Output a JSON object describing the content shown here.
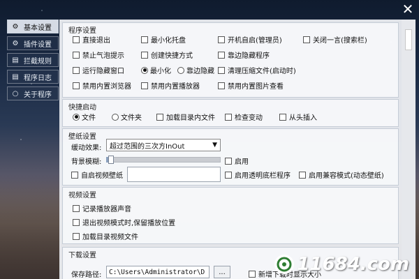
{
  "window": {
    "close_glyph": "✕"
  },
  "sidebar": {
    "items": [
      {
        "label": "基本设置",
        "icon": "gear-icon",
        "glyph": "⚙",
        "active": true
      },
      {
        "label": "插件设置",
        "icon": "plugin-icon",
        "glyph": "⚙",
        "active": false
      },
      {
        "label": "拦截规则",
        "icon": "rules-icon",
        "glyph": "▤",
        "active": false
      },
      {
        "label": "程序日志",
        "icon": "log-icon",
        "glyph": "▤",
        "active": false
      },
      {
        "label": "关于程序",
        "icon": "about-icon",
        "glyph": "○",
        "active": false
      }
    ]
  },
  "settings": {
    "program": {
      "title": "程序设置",
      "exit_direct": "直接退出",
      "minimize_tray": "最小化托盘",
      "autostart_admin": "开机自启(管理员)",
      "close_one_word": "关闭一言(搜索栏)",
      "disable_bubble": "禁止气泡提示",
      "create_shortcut": "创建快捷方式",
      "edge_hide": "靠边隐藏程序",
      "run_hide_window": "运行隐藏窗口",
      "radio_minimize": "最小化",
      "radio_edge_hide": "靠边隐藏",
      "clean_archives": "清理压缩文件(启动时)",
      "disable_browser": "禁用内置浏览器",
      "disable_player": "禁用内置播放器",
      "disable_image_viewer": "禁用内置图片查看"
    },
    "quick_start": {
      "title": "快捷启动",
      "radio_file": "文件",
      "radio_folder": "文件夹",
      "load_dir_files": "加载目录内文件",
      "check_changes": "检查变动",
      "insert_head": "从头插入"
    },
    "wallpaper": {
      "title": "壁纸设置",
      "easing_label": "缓动效果:",
      "easing_value": "超过范围的三次方InOut",
      "blur_label": "背景模糊:",
      "blur_value": 0.04,
      "enable": "启用",
      "autostart_video": "自启视频壁纸",
      "enable_transparent": "启用透明底栏程序",
      "enable_compat": "启用兼容模式(动态壁纸)"
    },
    "video": {
      "title": "视频设置",
      "record_player_sound": "记录播放器声音",
      "keep_position": "退出视频模式时,保留播放位置",
      "load_dir_videos": "加载目录视频文件"
    },
    "download": {
      "title": "下载设置",
      "save_path_label": "保存路径:",
      "save_path_value": "C:\\Users\\Administrator\\D",
      "browse": "...",
      "new_download_show": "新增下载时显示大小"
    }
  },
  "watermark": {
    "text": "11684.com"
  },
  "colors": {
    "panel_bg": "#f0f2f6",
    "accent": "#8aa0bd"
  }
}
